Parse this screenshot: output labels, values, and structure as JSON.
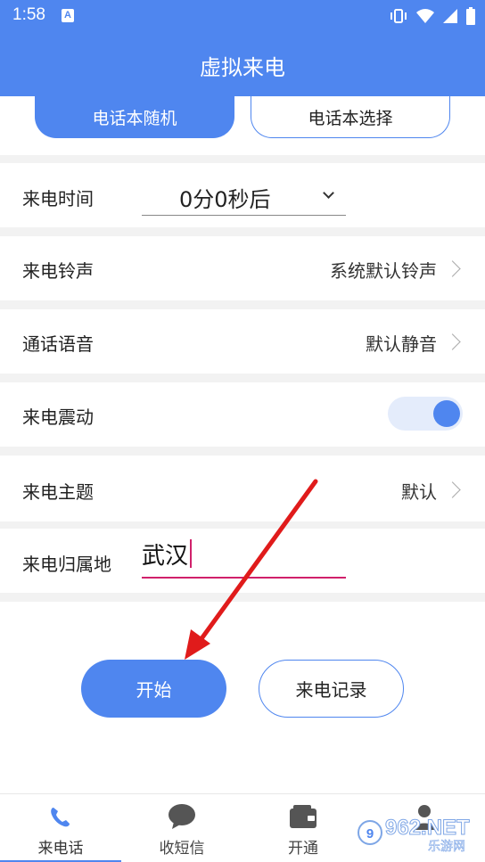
{
  "status_bar": {
    "time": "1:58",
    "notification_icon": "A"
  },
  "app_bar": {
    "title": "虚拟来电"
  },
  "segment": {
    "random_label": "电话本随机",
    "select_label": "电话本选择"
  },
  "settings": {
    "call_time": {
      "label": "来电时间",
      "value": "0分0秒后"
    },
    "ringtone": {
      "label": "来电铃声",
      "value": "系统默认铃声"
    },
    "voice": {
      "label": "通话语音",
      "value": "默认静音"
    },
    "vibrate": {
      "label": "来电震动",
      "enabled": true
    },
    "theme": {
      "label": "来电主题",
      "value": "默认"
    },
    "location": {
      "label": "来电归属地",
      "value": "武汉"
    }
  },
  "actions": {
    "start_label": "开始",
    "record_label": "来电记录"
  },
  "tabs": [
    {
      "label": "来电话",
      "icon": "phone-icon",
      "active": true
    },
    {
      "label": "收短信",
      "icon": "chat-bubble-icon",
      "active": false
    },
    {
      "label": "开通",
      "icon": "wallet-icon",
      "active": false
    },
    {
      "label": "",
      "icon": "user-icon",
      "active": false
    }
  ],
  "watermark": {
    "text": "962.NET",
    "subtext": "乐游网"
  },
  "colors": {
    "accent": "#4f86ef",
    "input_focus": "#d0216b",
    "annotation_arrow": "#e01b1b"
  }
}
